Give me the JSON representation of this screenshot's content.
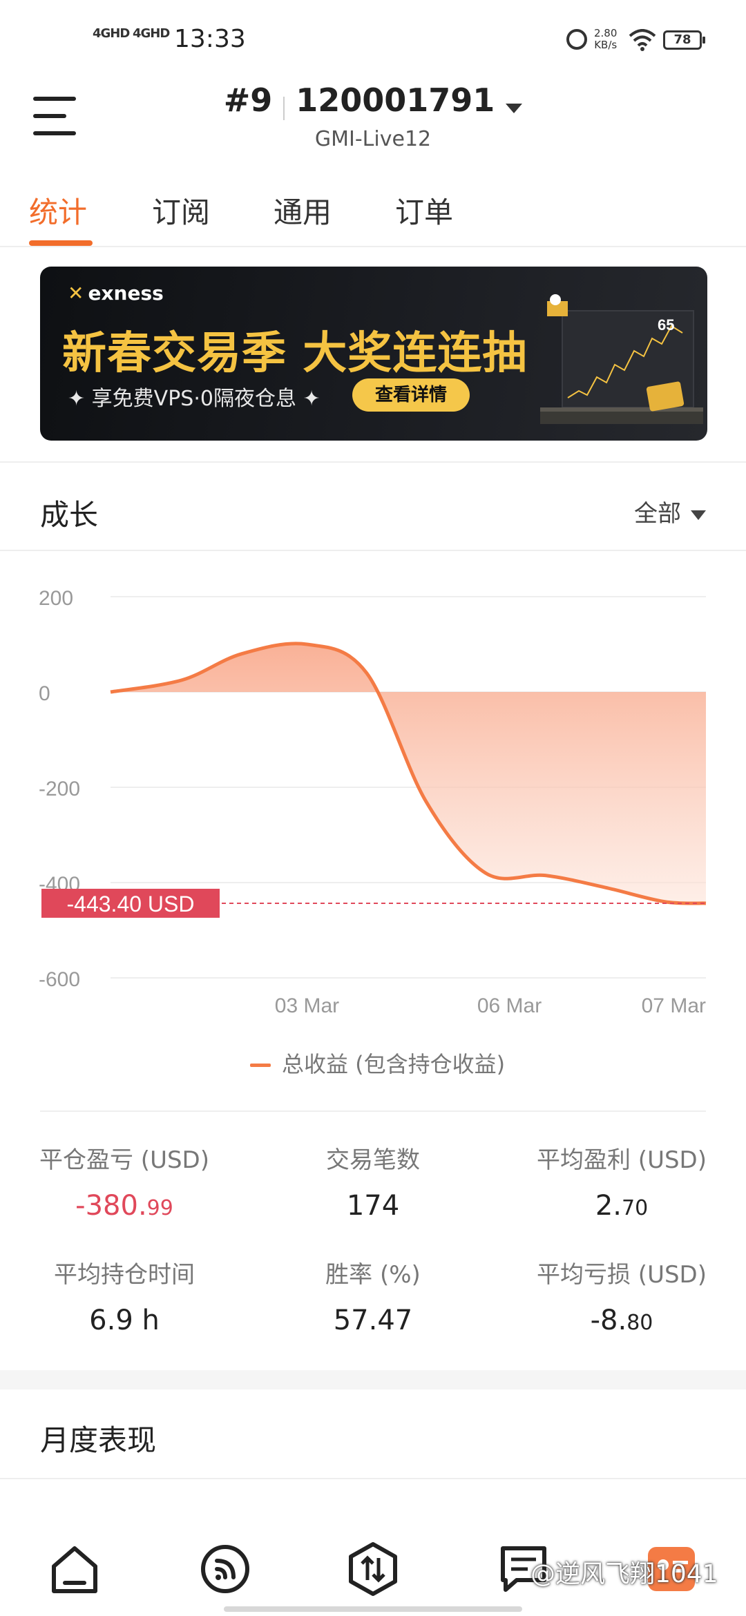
{
  "status_bar": {
    "network1": "4GHD",
    "network2": "4GHD",
    "time": "13:33",
    "speed_value": "2.80",
    "speed_unit": "KB/s",
    "battery": "78"
  },
  "header": {
    "account_num": "#9",
    "account_id": "120001791",
    "server": "GMI-Live12"
  },
  "tabs": [
    "统计",
    "订阅",
    "通用",
    "订单"
  ],
  "banner": {
    "brand": "exness",
    "title": "新春交易季 大奖连连抽",
    "subtitle": "✦ 享免费VPS·0隔夜仓息 ✦",
    "cta": "查看详情",
    "screen_text": "65"
  },
  "growth": {
    "title": "成长",
    "filter": "全部"
  },
  "chart_data": {
    "type": "area",
    "series": [
      {
        "name": "总收益 (包含持仓收益)",
        "color": "#f47b45",
        "x": [
          0,
          0.12,
          0.22,
          0.33,
          0.43,
          0.53,
          0.63,
          0.73,
          0.83,
          0.93,
          1.0
        ],
        "y": [
          0,
          25,
          80,
          100,
          40,
          -230,
          -380,
          -385,
          -410,
          -440,
          -443.4
        ]
      }
    ],
    "x_ticks": [
      {
        "label": "03 Mar",
        "x": 0.33
      },
      {
        "label": "06 Mar",
        "x": 0.67
      },
      {
        "label": "07 Mar",
        "x": 1.0
      }
    ],
    "y_ticks": [
      200,
      0,
      -200,
      -400,
      -600
    ],
    "ylim": [
      -600,
      200
    ],
    "current_value": -443.4,
    "current_label": "-443.40 USD",
    "current_color": "#e0485a",
    "legend": "总收益 (包含持仓收益)",
    "grid": true
  },
  "stats": [
    {
      "label": "平仓盈亏 (USD)",
      "value_int": "-380.",
      "value_dec": "99",
      "negative": true
    },
    {
      "label": "交易笔数",
      "value_int": "174",
      "value_dec": "",
      "negative": false
    },
    {
      "label": "平均盈利 (USD)",
      "value_int": "2.",
      "value_dec": "70",
      "negative": false
    },
    {
      "label": "平均持仓时间",
      "value_int": "6.9 h",
      "value_dec": "",
      "negative": false
    },
    {
      "label": "胜率 (%)",
      "value_int": "57.47",
      "value_dec": "",
      "negative": false
    },
    {
      "label": "平均亏损 (USD)",
      "value_int": "-8.",
      "value_dec": "80",
      "negative": false
    }
  ],
  "monthly": {
    "title": "月度表现"
  },
  "watermark": "@逆风飞翔1041",
  "colors": {
    "accent": "#f26d2b",
    "negative": "#e0485a"
  }
}
